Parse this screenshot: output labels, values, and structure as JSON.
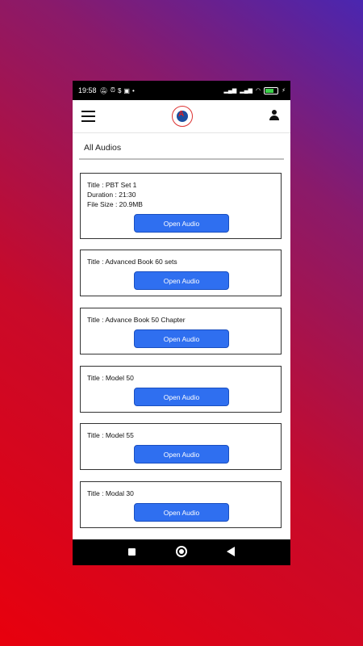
{
  "status": {
    "time": "19:58",
    "battery_color": "#3cd04a"
  },
  "appbar": {
    "menu_icon": "hamburger-menu-icon",
    "logo_icon": "app-logo",
    "user_icon": "user-profile-icon"
  },
  "section": {
    "title": "All Audios"
  },
  "cards": [
    {
      "lines": [
        "Title : PBT Set 1",
        "Duration : 21:30",
        "File Size : 20.9MB"
      ],
      "button": "Open Audio"
    },
    {
      "lines": [
        "Title : Advanced Book 60 sets"
      ],
      "button": "Open Audio"
    },
    {
      "lines": [
        "Title : Advance Book 50 Chapter"
      ],
      "button": "Open Audio"
    },
    {
      "lines": [
        "Title : Model 50"
      ],
      "button": "Open Audio"
    },
    {
      "lines": [
        "Title : Model 55"
      ],
      "button": "Open Audio"
    },
    {
      "lines": [
        "Title : Modal 30"
      ],
      "button": "Open Audio"
    }
  ],
  "colors": {
    "button": "#2f6ff0",
    "background_start": "#e8000d",
    "background_end": "#4a26b0"
  }
}
